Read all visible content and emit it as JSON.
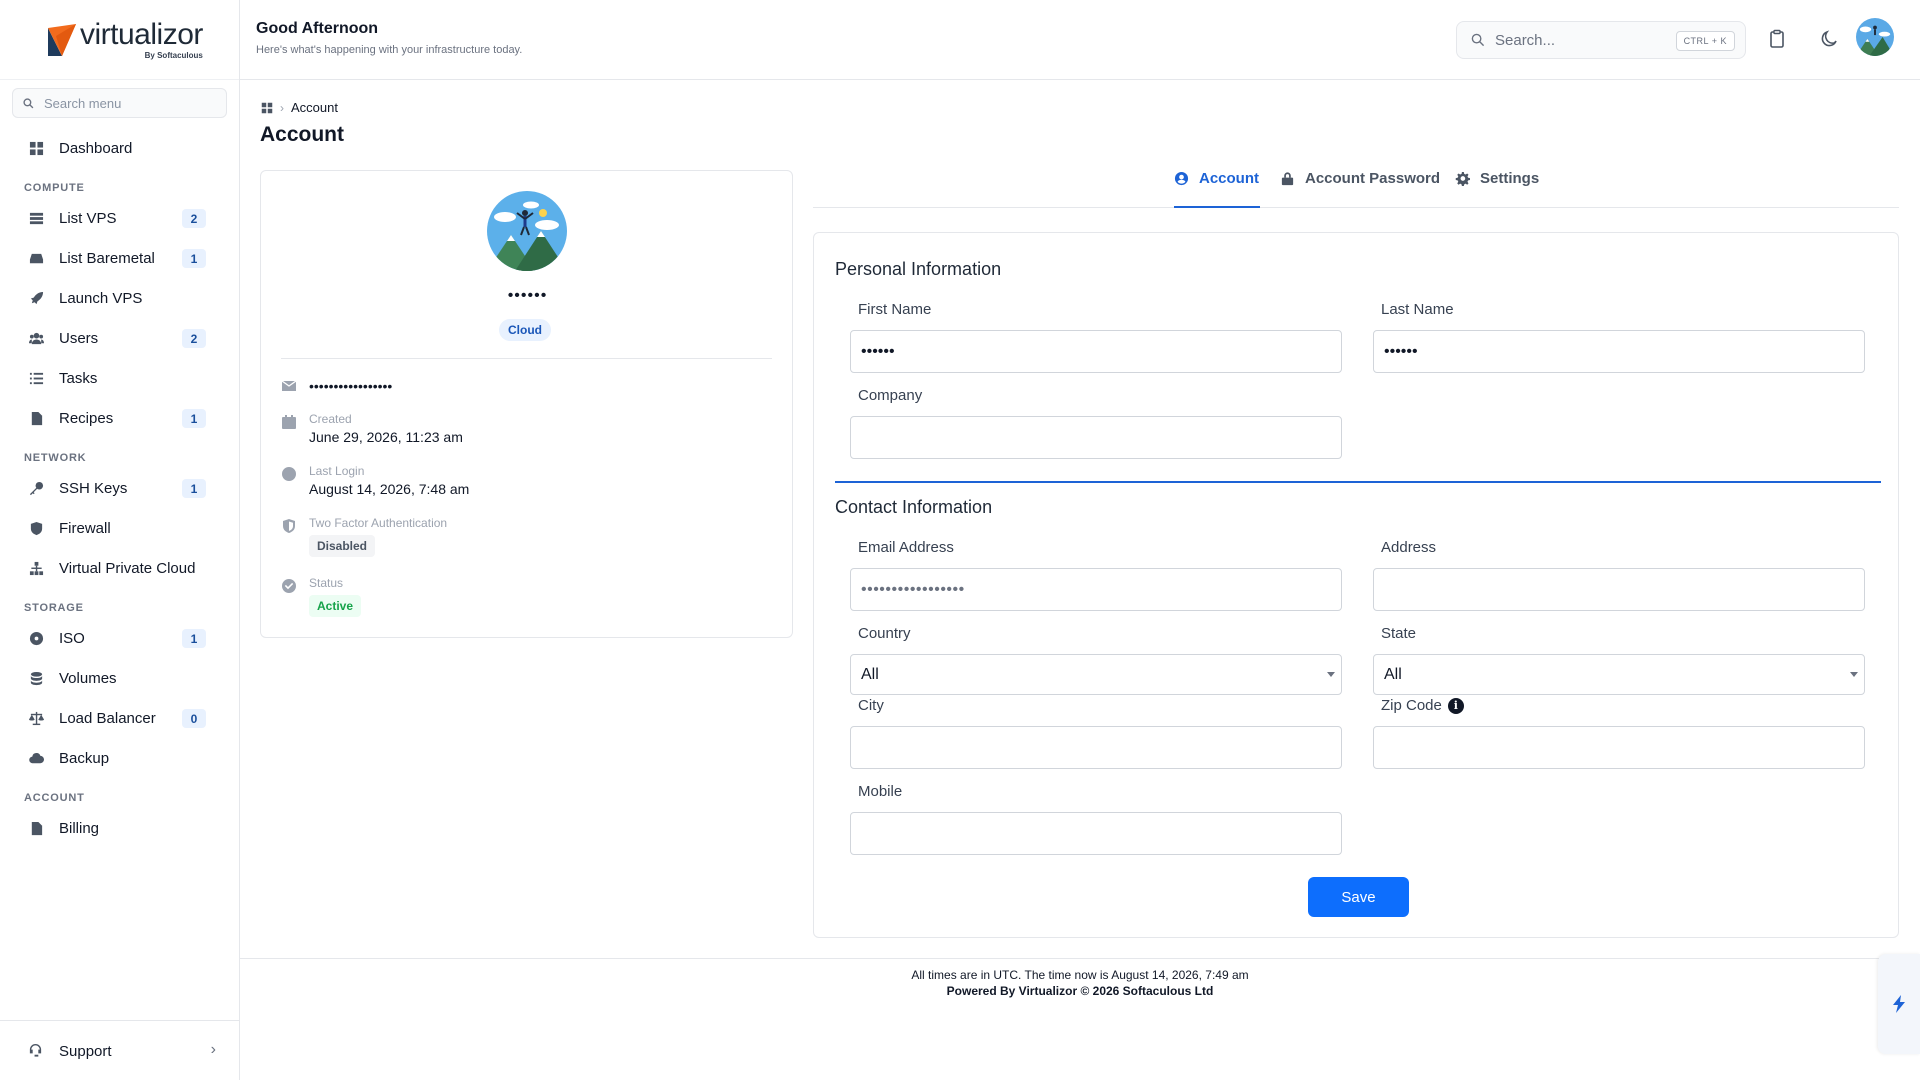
{
  "brand": {
    "name": "virtualizor",
    "tagline": "By Softaculous"
  },
  "sidebar": {
    "search_placeholder": "Search menu",
    "dashboard": {
      "label": "Dashboard",
      "icon": "grid-icon"
    },
    "sections": [
      {
        "title": "COMPUTE",
        "items": [
          {
            "label": "List VPS",
            "badge": "2",
            "icon": "server-icon"
          },
          {
            "label": "List Baremetal",
            "badge": "1",
            "icon": "hard-drive-icon"
          },
          {
            "label": "Launch VPS",
            "badge": "",
            "icon": "rocket-icon"
          },
          {
            "label": "Users",
            "badge": "2",
            "icon": "users-icon"
          },
          {
            "label": "Tasks",
            "badge": "",
            "icon": "list-check-icon"
          },
          {
            "label": "Recipes",
            "badge": "1",
            "icon": "file-code-icon"
          }
        ]
      },
      {
        "title": "NETWORK",
        "items": [
          {
            "label": "SSH Keys",
            "badge": "1",
            "icon": "key-icon"
          },
          {
            "label": "Firewall",
            "badge": "",
            "icon": "shield-icon"
          },
          {
            "label": "Virtual Private Cloud",
            "badge": "",
            "icon": "sitemap-icon"
          }
        ]
      },
      {
        "title": "STORAGE",
        "items": [
          {
            "label": "ISO",
            "badge": "1",
            "icon": "disc-icon"
          },
          {
            "label": "Volumes",
            "badge": "",
            "icon": "database-icon"
          },
          {
            "label": "Load Balancer",
            "badge": "0",
            "icon": "scale-icon"
          },
          {
            "label": "Backup",
            "badge": "",
            "icon": "cloud-upload-icon"
          }
        ]
      },
      {
        "title": "ACCOUNT",
        "items": [
          {
            "label": "Billing",
            "badge": "",
            "icon": "invoice-icon"
          }
        ]
      }
    ],
    "support": {
      "label": "Support",
      "icon": "headset-icon"
    }
  },
  "header": {
    "greeting": "Good Afternoon",
    "subtitle": "Here's what's happening with your infrastructure today.",
    "search_placeholder": "Search...",
    "shortcut": "CTRL + K"
  },
  "breadcrumb": {
    "home_icon": "grid-icon",
    "current": "Account"
  },
  "page_title": "Account",
  "profile": {
    "name": "••••••",
    "plan": "Cloud",
    "email": "•••••••••••••••••",
    "created_label": "Created",
    "created_value": "June 29, 2026, 11:23 am",
    "last_login_label": "Last Login",
    "last_login_value": "August 14, 2026, 7:48 am",
    "twofa_label": "Two Factor Authentication",
    "twofa_value": "Disabled",
    "status_label": "Status",
    "status_value": "Active"
  },
  "tabs": [
    {
      "label": "Account",
      "icon": "user-circle-icon",
      "active": true
    },
    {
      "label": "Account Password",
      "icon": "lock-icon",
      "active": false
    },
    {
      "label": "Settings",
      "icon": "gear-icon",
      "active": false
    }
  ],
  "form": {
    "personal_title": "Personal Information",
    "first_name_label": "First Name",
    "first_name_value": "••••••",
    "last_name_label": "Last Name",
    "last_name_value": "••••••",
    "company_label": "Company",
    "company_value": "",
    "contact_title": "Contact Information",
    "email_label": "Email Address",
    "email_value": "•••••••••••••••••",
    "address_label": "Address",
    "address_value": "",
    "country_label": "Country",
    "country_value": "All",
    "state_label": "State",
    "state_value": "All",
    "city_label": "City",
    "city_value": "",
    "zip_label": "Zip Code",
    "zip_value": "",
    "mobile_label": "Mobile",
    "mobile_value": "",
    "save_label": "Save"
  },
  "footer": {
    "timezone_note": "All times are in UTC. The time now is August 14, 2026, 7:49 am",
    "powered": "Powered By Virtualizor © 2026 Softaculous Ltd"
  },
  "colors": {
    "accent": "#1d63d6",
    "button": "#0d6efd",
    "badge_bg": "#e8f1fe",
    "active_green": "#16a34a"
  }
}
